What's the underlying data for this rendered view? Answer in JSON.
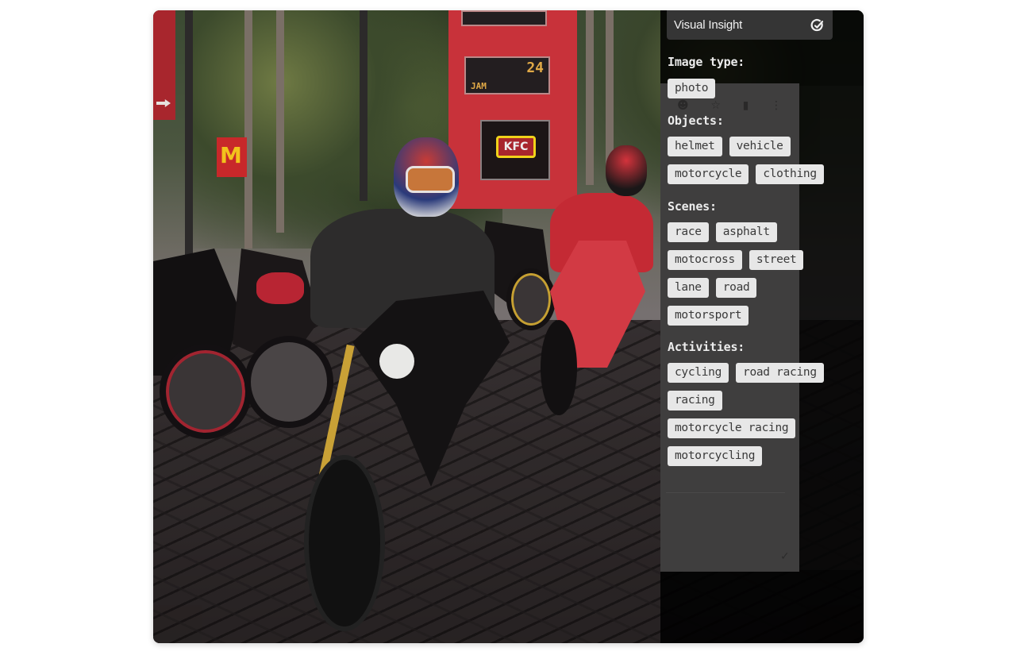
{
  "photo": {
    "description": "Motorcyclists riding on paved street near KFC sign",
    "sign_text": {
      "top_display": "24",
      "time_display": "24",
      "time_label": "JAM",
      "brand": "KFC",
      "left_brand": "M"
    }
  },
  "insight_panel": {
    "title": "Visual Insight",
    "header_icon": "edit-check-icon",
    "sections": [
      {
        "label": "Image type:",
        "tags": [
          "photo"
        ]
      },
      {
        "label": "Objects:",
        "tags": [
          "helmet",
          "vehicle",
          "motorcycle",
          "clothing"
        ]
      },
      {
        "label": "Scenes:",
        "tags": [
          "race",
          "asphalt",
          "motocross",
          "street",
          "lane",
          "road",
          "motorsport"
        ]
      },
      {
        "label": "Activities:",
        "tags": [
          "cycling",
          "road racing",
          "racing",
          "motorcycle racing",
          "motorcycling"
        ]
      }
    ]
  },
  "background_panel": {
    "icons": [
      "person-icon",
      "star-icon",
      "trash-icon",
      "more-vert-icon"
    ],
    "glyphs": [
      "☻",
      "☆",
      "▮",
      "⋮"
    ],
    "confirm_glyph": "✓"
  },
  "colors": {
    "panel_bg": "#353535",
    "tag_bg": "#e7e7e7",
    "tag_text": "#3a3a3a",
    "label_text": "#ececec",
    "overlay": "#000000"
  }
}
